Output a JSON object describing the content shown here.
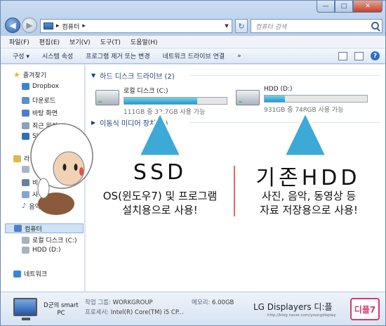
{
  "window": {
    "caption_min": "—",
    "caption_max": "□",
    "caption_close": "✕",
    "back_glyph": "◀",
    "forward_glyph": "▶",
    "refresh_glyph": "↻",
    "address_path": "컴퓨터",
    "address_sep": "▸",
    "address_drop": "▼",
    "search_placeholder": "컴퓨터 검색"
  },
  "menu": [
    "파일(F)",
    "편집(E)",
    "보기(V)",
    "도구(T)",
    "도움말(H)"
  ],
  "toolbar": {
    "items": [
      "구성 ▾",
      "시스템 속성",
      "프로그램 제거 또는 변경",
      "네트워크 드라이브 연결",
      "»"
    ]
  },
  "nav": {
    "favorites": "즐겨찾기",
    "dropbox": "Dropbox",
    "downloads": "다운로드",
    "desktop": "바탕 화면",
    "recent": "최근 위치",
    "sky": "Sk",
    "lib": "라",
    "lib_b": "비",
    "lib_s": "사",
    "lib_m": "음악",
    "computer": "컴퓨터",
    "drive_c": "로컬 디스크 (C:)",
    "drive_d": "HDD (D:)",
    "network": "네트워크"
  },
  "content": {
    "hdd_group": "하드 디스크 드라이브 (2)",
    "removable_group": "이동식 미디어 장치 (2)",
    "drives": [
      {
        "name": "로컬 디스크 (C:)",
        "free_text": "111GB 중 32.7GB 사용 가능",
        "used_fraction": 0.71
      },
      {
        "name": "HDD (D:)",
        "free_text": "931GB 중 748GB 사용 가능",
        "used_fraction": 0.2
      }
    ]
  },
  "details": {
    "pc_name": "D군의 smart PC",
    "workgroup_label": "작업 그룹:",
    "workgroup": "WORKGROUP",
    "memory_label": "메모리:",
    "memory": "6.00GB",
    "cpu_label": "프로세서:",
    "cpu": "Intel(R) Core(TM) i5 CP..."
  },
  "branding": {
    "title": "LG Displayers 디:플",
    "url": "http://blog.naver.com/youngdisplay",
    "logo": "디플7"
  },
  "annotations": {
    "ssd_title": "SSD",
    "ssd_desc1": "OS(윈도우7) 및 프로그램",
    "ssd_desc2": "설치용으로 사용!",
    "hdd_title": "기존HDD",
    "hdd_desc1": "사진, 음악, 동영상 등",
    "hdd_desc2": "자료 저장용으로 사용!"
  },
  "colors": {
    "accent": "#1e9cc8",
    "window_frame": "#d9e6f5",
    "arrow": "#3ca9d6",
    "divider": "#e06a6a"
  }
}
